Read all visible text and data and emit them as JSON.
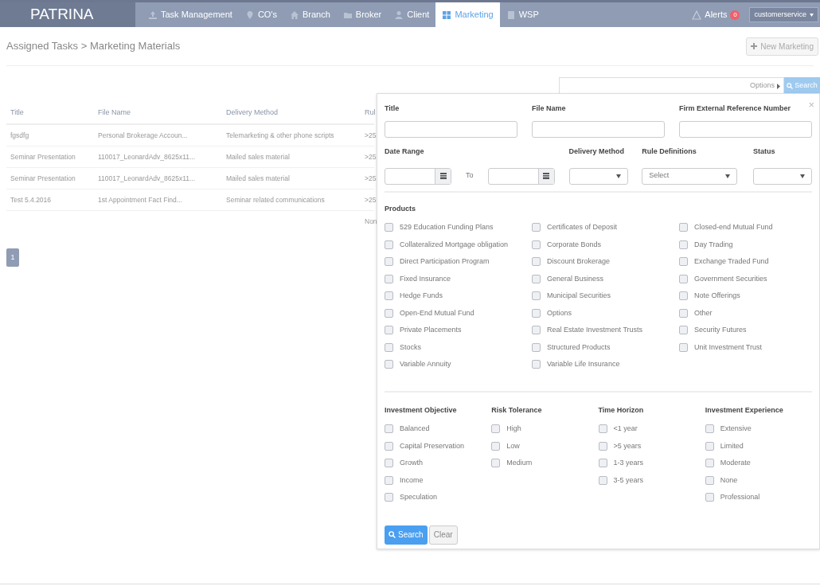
{
  "nav": {
    "logo": "PATRINA",
    "items": [
      {
        "label": "Task Management",
        "kind": "upload",
        "selected": false
      },
      {
        "label": "CO's",
        "kind": "pin",
        "selected": false
      },
      {
        "label": "Branch",
        "kind": "home",
        "selected": false
      },
      {
        "label": "Broker",
        "kind": "folder",
        "selected": false
      },
      {
        "label": "Client",
        "kind": "user",
        "selected": false
      },
      {
        "label": "Marketing",
        "kind": "grid",
        "selected": true
      },
      {
        "label": "WSP",
        "kind": "book",
        "selected": false
      }
    ],
    "alerts": {
      "label": "Alerts",
      "count": "0"
    },
    "user": "customerservice"
  },
  "breadcrumb": "Assigned Tasks > Marketing Materials",
  "new_button": "New Marketing",
  "search_bar": {
    "options": "Options",
    "search": "Search"
  },
  "table": {
    "columns": [
      "Title",
      "File Name",
      "Delivery Method",
      "Rul"
    ],
    "rows": [
      [
        "fgsdfg",
        "Personal Brokerage Accoun...",
        "Telemarketing & other phone scripts",
        ">25"
      ],
      [
        "Seminar Presentation",
        "110017_LeonardAdv_8625x11...",
        "Mailed sales material",
        ">25"
      ],
      [
        "Seminar Presentation",
        "110017_LeonardAdv_8625x11...",
        "Mailed sales material",
        ">25"
      ],
      [
        "Test 5.4.2016",
        "1st Appointment Fact Find...",
        "Seminar related communications",
        ">25"
      ]
    ],
    "footer": "Non"
  },
  "pagination": [
    {
      "label": "1",
      "selected": true
    }
  ],
  "filter": {
    "close": "×",
    "title": {
      "label": "Title"
    },
    "file_name": {
      "label": "File Name"
    },
    "firm_ref": {
      "label": "Firm External Reference Number"
    },
    "date_range": {
      "label": "Date Range",
      "to": "To"
    },
    "delivery_method": {
      "label": "Delivery Method"
    },
    "rule_definitions": {
      "label": "Rule Definitions",
      "value": "Select"
    },
    "status": {
      "label": "Status"
    },
    "products": {
      "label": "Products",
      "items": [
        {
          "label": "529 Education Funding Plans",
          "checked": false
        },
        {
          "label": "Certificates of Deposit",
          "checked": false
        },
        {
          "label": "Closed-end Mutual Fund",
          "checked": false
        },
        {
          "label": "Collateralized Mortgage obligation",
          "checked": false
        },
        {
          "label": "Corporate Bonds",
          "checked": false
        },
        {
          "label": "Day Trading",
          "checked": false
        },
        {
          "label": "Direct Participation Program",
          "checked": false
        },
        {
          "label": "Discount Brokerage",
          "checked": false
        },
        {
          "label": "Exchange Traded Fund",
          "checked": false
        },
        {
          "label": "Fixed Insurance",
          "checked": false
        },
        {
          "label": "General Business",
          "checked": false
        },
        {
          "label": "Government Securities",
          "checked": false
        },
        {
          "label": "Hedge Funds",
          "checked": false
        },
        {
          "label": "Municipal Securities",
          "checked": false
        },
        {
          "label": "Note Offerings",
          "checked": false
        },
        {
          "label": "Open-End Mutual Fund",
          "checked": false
        },
        {
          "label": "Options",
          "checked": false
        },
        {
          "label": "Other",
          "checked": false
        },
        {
          "label": "Private Placements",
          "checked": false
        },
        {
          "label": "Real Estate Investment Trusts",
          "checked": false
        },
        {
          "label": "Security Futures",
          "checked": false
        },
        {
          "label": "Stocks",
          "checked": false
        },
        {
          "label": "Structured Products",
          "checked": false
        },
        {
          "label": "Unit Investment Trust",
          "checked": false
        },
        {
          "label": "Variable Annuity",
          "checked": false
        },
        {
          "label": "Variable Life Insurance",
          "checked": false
        }
      ]
    },
    "groups": [
      {
        "label": "Investment Objective",
        "items": [
          {
            "label": "Balanced",
            "checked": false
          },
          {
            "label": "Capital Preservation",
            "checked": false
          },
          {
            "label": "Growth",
            "checked": false
          },
          {
            "label": "Income",
            "checked": false
          },
          {
            "label": "Speculation",
            "checked": false
          }
        ]
      },
      {
        "label": "Risk Tolerance",
        "items": [
          {
            "label": "High",
            "checked": false
          },
          {
            "label": "Low",
            "checked": false
          },
          {
            "label": "Medium",
            "checked": false
          }
        ]
      },
      {
        "label": "Time Horizon",
        "items": [
          {
            "label": "<1 year",
            "checked": false
          },
          {
            "label": ">5 years",
            "checked": false
          },
          {
            "label": "1-3 years",
            "checked": false
          },
          {
            "label": "3-5 years",
            "checked": false
          }
        ]
      },
      {
        "label": "Investment Experience",
        "items": [
          {
            "label": "Extensive",
            "checked": false
          },
          {
            "label": "Limited",
            "checked": false
          },
          {
            "label": "Moderate",
            "checked": false
          },
          {
            "label": "None",
            "checked": false
          },
          {
            "label": "Professional",
            "checked": false
          }
        ]
      }
    ],
    "search": "Search",
    "clear": "Clear"
  }
}
